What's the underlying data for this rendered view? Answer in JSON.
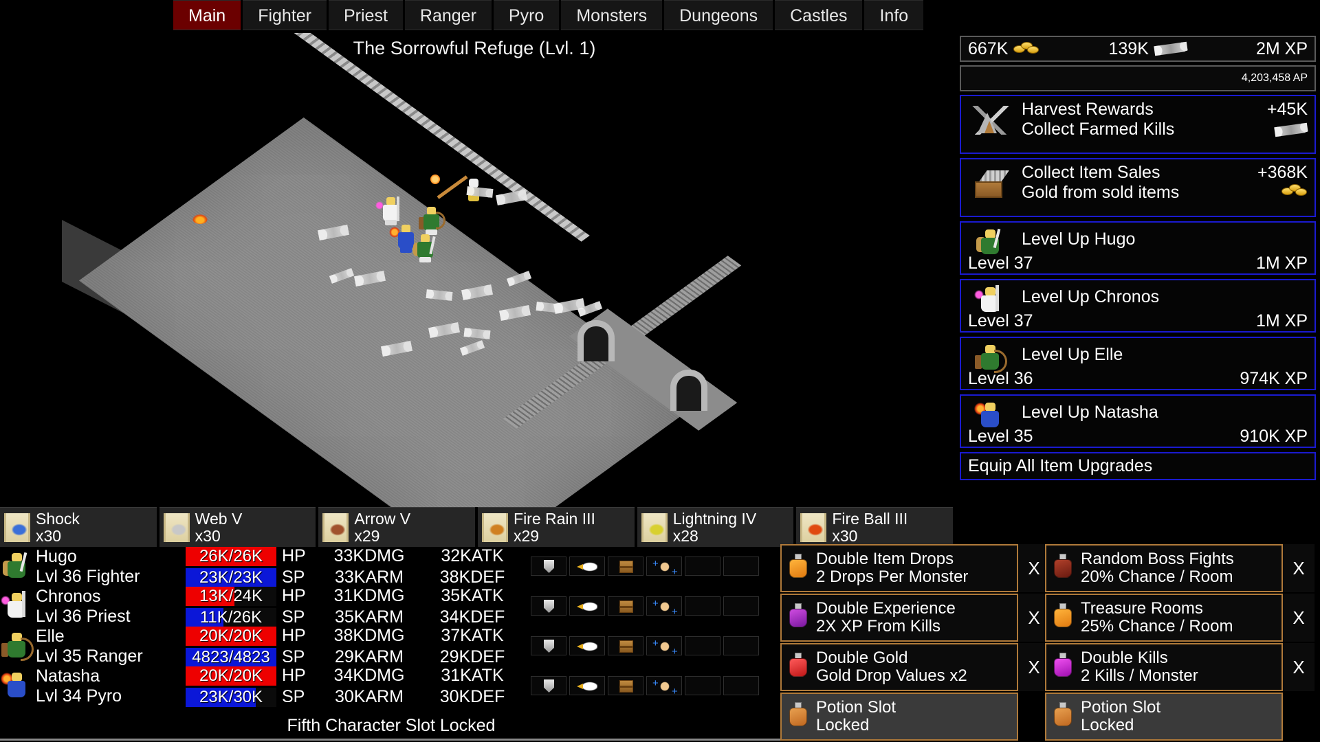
{
  "nav": {
    "tabs": [
      {
        "label": "Main",
        "active": true
      },
      {
        "label": "Fighter",
        "active": false
      },
      {
        "label": "Priest",
        "active": false
      },
      {
        "label": "Ranger",
        "active": false
      },
      {
        "label": "Pyro",
        "active": false
      },
      {
        "label": "Monsters",
        "active": false
      },
      {
        "label": "Dungeons",
        "active": false
      },
      {
        "label": "Castles",
        "active": false
      },
      {
        "label": "Info",
        "active": false
      }
    ]
  },
  "map": {
    "title": "The Sorrowful Refuge (Lvl. 1)"
  },
  "resources": {
    "gold": "667K",
    "gold_icon": "gold-coins-icon",
    "bones": "139K",
    "bones_icon": "bone-icon",
    "xp": "2M XP",
    "ap": "4,203,458 AP"
  },
  "rewards": [
    {
      "icon": "tent-icon",
      "title": "Harvest Rewards",
      "amount": "+45K",
      "subtitle": "Collect Farmed Kills",
      "sub_icon": "bone-icon",
      "sub_value": ""
    },
    {
      "icon": "house-icon",
      "title": "Collect Item Sales",
      "amount": "+368K",
      "subtitle": "Gold from sold items",
      "sub_icon": "gold-coins-icon",
      "sub_value": ""
    }
  ],
  "levelups": [
    {
      "icon": "fighter-portrait-icon",
      "class": "f",
      "title": "Level Up Hugo",
      "level": "Level 37",
      "xp": "1M XP"
    },
    {
      "icon": "priest-portrait-icon",
      "class": "p",
      "title": "Level Up Chronos",
      "level": "Level 37",
      "xp": "1M XP"
    },
    {
      "icon": "ranger-portrait-icon",
      "class": "r",
      "title": "Level Up Elle",
      "level": "Level 36",
      "xp": "974K XP"
    },
    {
      "icon": "pyro-portrait-icon",
      "class": "y",
      "title": "Level Up Natasha",
      "level": "Level 35",
      "xp": "910K XP"
    }
  ],
  "equip_all": {
    "label": "Equip All Item Upgrades"
  },
  "spells": [
    {
      "name": "Shock",
      "qty": "x30",
      "icon": "scroll-shock-icon",
      "color": "#3a6fd8"
    },
    {
      "name": "Web V",
      "qty": "x30",
      "icon": "scroll-web-icon",
      "color": "#c8c8c8"
    },
    {
      "name": "Arrow V",
      "qty": "x29",
      "icon": "scroll-arrow-icon",
      "color": "#a0522d"
    },
    {
      "name": "Fire Rain III",
      "qty": "x29",
      "icon": "scroll-firerain-icon",
      "color": "#d08020"
    },
    {
      "name": "Lightning IV",
      "qty": "x28",
      "icon": "scroll-lightning-icon",
      "color": "#d8d030"
    },
    {
      "name": "Fire Ball III",
      "qty": "x30",
      "icon": "scroll-fireball-icon",
      "color": "#e04a10"
    }
  ],
  "characters": [
    {
      "portrait": "fighter-portrait-icon",
      "class": "f",
      "name": "Hugo",
      "subtitle": "Lvl 36 Fighter",
      "hp_text": "26K/26K",
      "hp_pct": 100,
      "sp_text": "23K/23K",
      "sp_pct": 100,
      "hp_label": "HP",
      "sp_label": "SP",
      "dmg": "33KDMG",
      "atk": "32KATK",
      "arm": "33KARM",
      "def": "38KDEF",
      "slots": [
        "shield",
        "eagle",
        "chest",
        "muscle",
        "empty",
        "empty"
      ]
    },
    {
      "portrait": "priest-portrait-icon",
      "class": "p",
      "name": "Chronos",
      "subtitle": "Lvl 36 Priest",
      "hp_text": "13K/24K",
      "hp_pct": 54,
      "sp_text": "11K/26K",
      "sp_pct": 42,
      "hp_label": "HP",
      "sp_label": "SP",
      "dmg": "31KDMG",
      "atk": "35KATK",
      "arm": "35KARM",
      "def": "34KDEF",
      "slots": [
        "shield",
        "eagle",
        "chest",
        "muscle",
        "empty",
        "empty"
      ]
    },
    {
      "portrait": "ranger-portrait-icon",
      "class": "r",
      "name": "Elle",
      "subtitle": "Lvl 35 Ranger",
      "hp_text": "20K/20K",
      "hp_pct": 100,
      "sp_text": "4823/4823",
      "sp_pct": 100,
      "hp_label": "HP",
      "sp_label": "SP",
      "dmg": "38KDMG",
      "atk": "37KATK",
      "arm": "29KARM",
      "def": "29KDEF",
      "slots": [
        "shield",
        "eagle",
        "chest",
        "muscle",
        "empty",
        "empty"
      ]
    },
    {
      "portrait": "pyro-portrait-icon",
      "class": "y",
      "name": "Natasha",
      "subtitle": "Lvl 34 Pyro",
      "hp_text": "20K/20K",
      "hp_pct": 100,
      "sp_text": "23K/30K",
      "sp_pct": 77,
      "hp_label": "HP",
      "sp_label": "SP",
      "dmg": "34KDMG",
      "atk": "31KATK",
      "arm": "30KARM",
      "def": "30KDEF",
      "slots": [
        "shield",
        "eagle",
        "chest",
        "muscle",
        "empty",
        "empty"
      ]
    }
  ],
  "fifth_slot": {
    "label": "Fifth Character Slot Locked"
  },
  "potions_left": [
    {
      "name": "Double Item Drops",
      "desc": "2 Drops Per Monster",
      "icon": "potion-orange-icon",
      "color1": "#ffb43c",
      "color2": "#e07a10",
      "locked": false,
      "remove": "X"
    },
    {
      "name": "Double Experience",
      "desc": "2X XP From Kills",
      "icon": "potion-purple-icon",
      "color1": "#cf4ce0",
      "color2": "#7a18a0",
      "locked": false,
      "remove": "X"
    },
    {
      "name": "Double Gold",
      "desc": "Gold Drop Values x2",
      "icon": "potion-red-icon",
      "color1": "#ff5a5a",
      "color2": "#c01818",
      "locked": false,
      "remove": "X"
    },
    {
      "name": "Potion Slot",
      "desc": "Locked",
      "icon": "potion-locked-icon",
      "color1": "#e8a050",
      "color2": "#c06820",
      "locked": true,
      "remove": ""
    }
  ],
  "potions_right": [
    {
      "name": "Random Boss Fights",
      "desc": "20% Chance / Room",
      "icon": "potion-darkred-icon",
      "color1": "#b0402a",
      "color2": "#6a1a10",
      "locked": false,
      "remove": "X"
    },
    {
      "name": "Treasure Rooms",
      "desc": "25% Chance / Room",
      "icon": "potion-orange-icon",
      "color1": "#ffb43c",
      "color2": "#e07a10",
      "locked": false,
      "remove": "X"
    },
    {
      "name": "Double Kills",
      "desc": "2 Kills / Monster",
      "icon": "potion-magenta-icon",
      "color1": "#f050f0",
      "color2": "#a010b0",
      "locked": false,
      "remove": "X"
    },
    {
      "name": "Potion Slot",
      "desc": "Locked",
      "icon": "potion-locked-icon",
      "color1": "#e8a050",
      "color2": "#c06820",
      "locked": true,
      "remove": ""
    }
  ],
  "colors": {
    "accent_blue": "#1a1ad0",
    "accent_orange": "#b07a3a",
    "active_tab": "#6b0000",
    "hp_bar": "#ee0000",
    "sp_bar": "#0b17d8"
  }
}
